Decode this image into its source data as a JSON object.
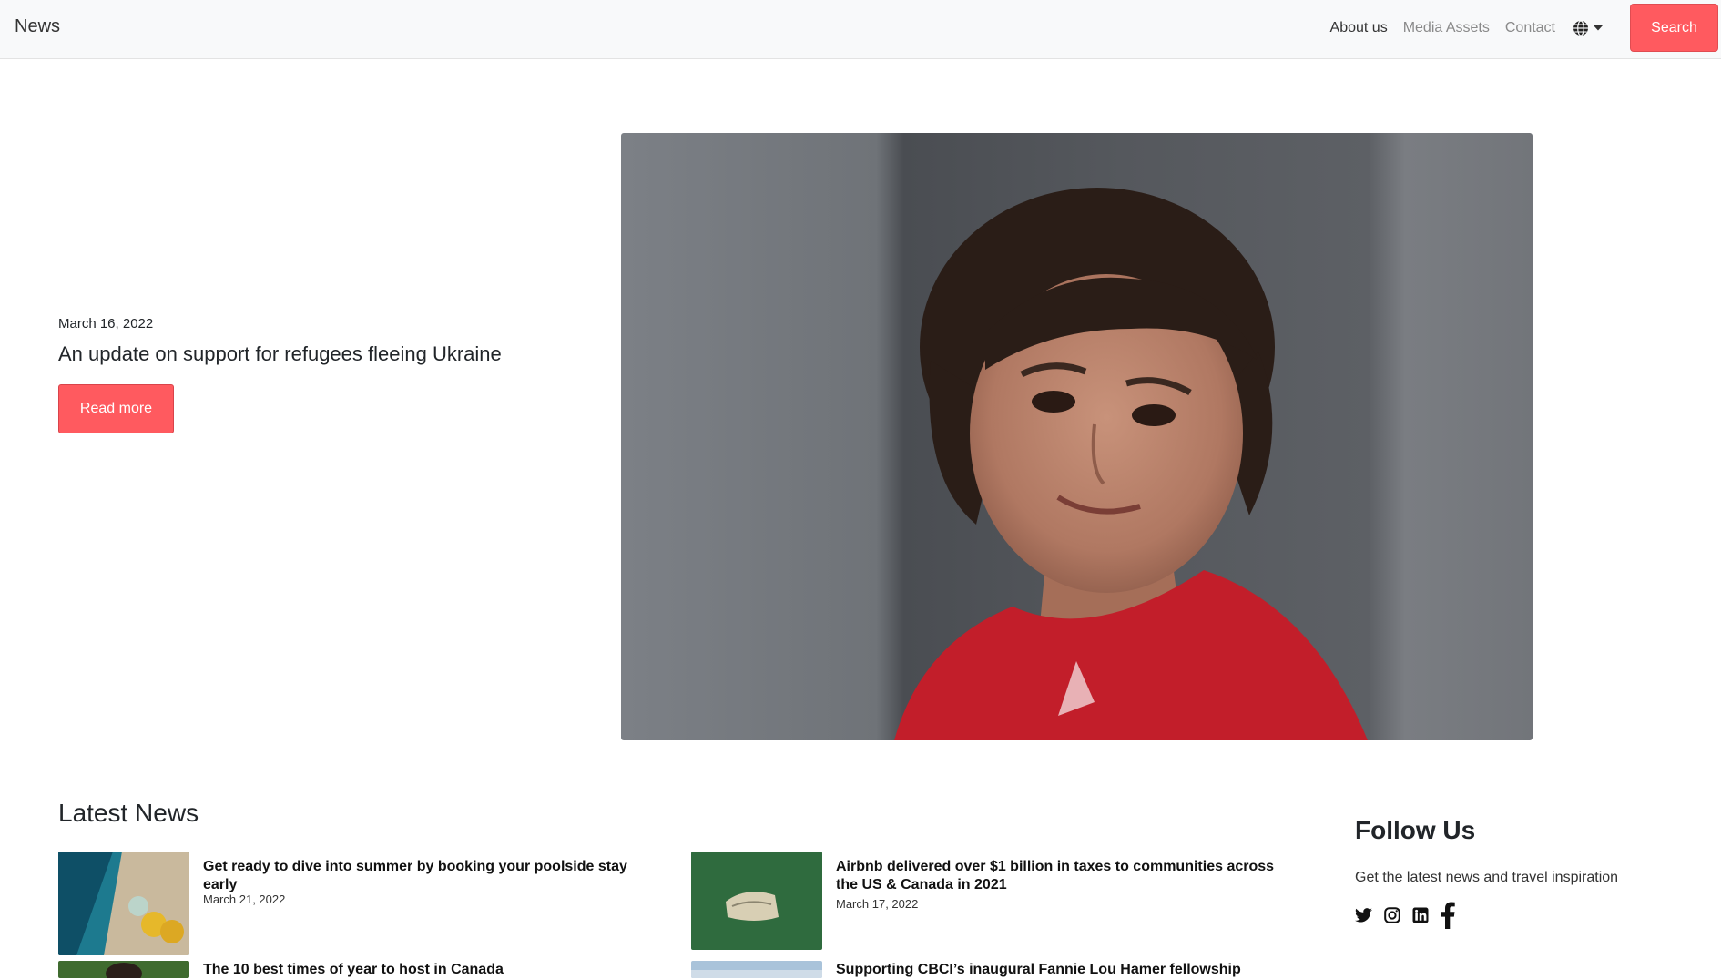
{
  "navbar": {
    "brand": "News",
    "links": [
      "About us",
      "Media Assets",
      "Contact"
    ],
    "language_icon": "globe-icon",
    "search_label": "Search"
  },
  "hero": {
    "date": "March 16, 2022",
    "title": "An update on support for refugees fleeing Ukraine",
    "button_label": "Read more"
  },
  "latest": {
    "title": "Latest News",
    "items": [
      {
        "title": "Get ready to dive into summer by booking your poolside stay early",
        "date": "March 21, 2022"
      },
      {
        "title": "Airbnb delivered over $1 billion in taxes to communities across the US & Canada in 2021",
        "date": "March 17, 2022"
      },
      {
        "title": "The 10 best times of year to host in Canada",
        "date": ""
      },
      {
        "title": "Supporting CBCI’s inaugural Fannie Lou Hamer fellowship",
        "date": ""
      }
    ]
  },
  "follow": {
    "title": "Follow Us",
    "text": "Get the latest news and travel inspiration",
    "icons": [
      "twitter-icon",
      "instagram-icon",
      "linkedin-icon",
      "facebook-icon"
    ]
  },
  "colors": {
    "accent": "#ff5a5f",
    "navbar_bg": "#f8f9fa"
  }
}
